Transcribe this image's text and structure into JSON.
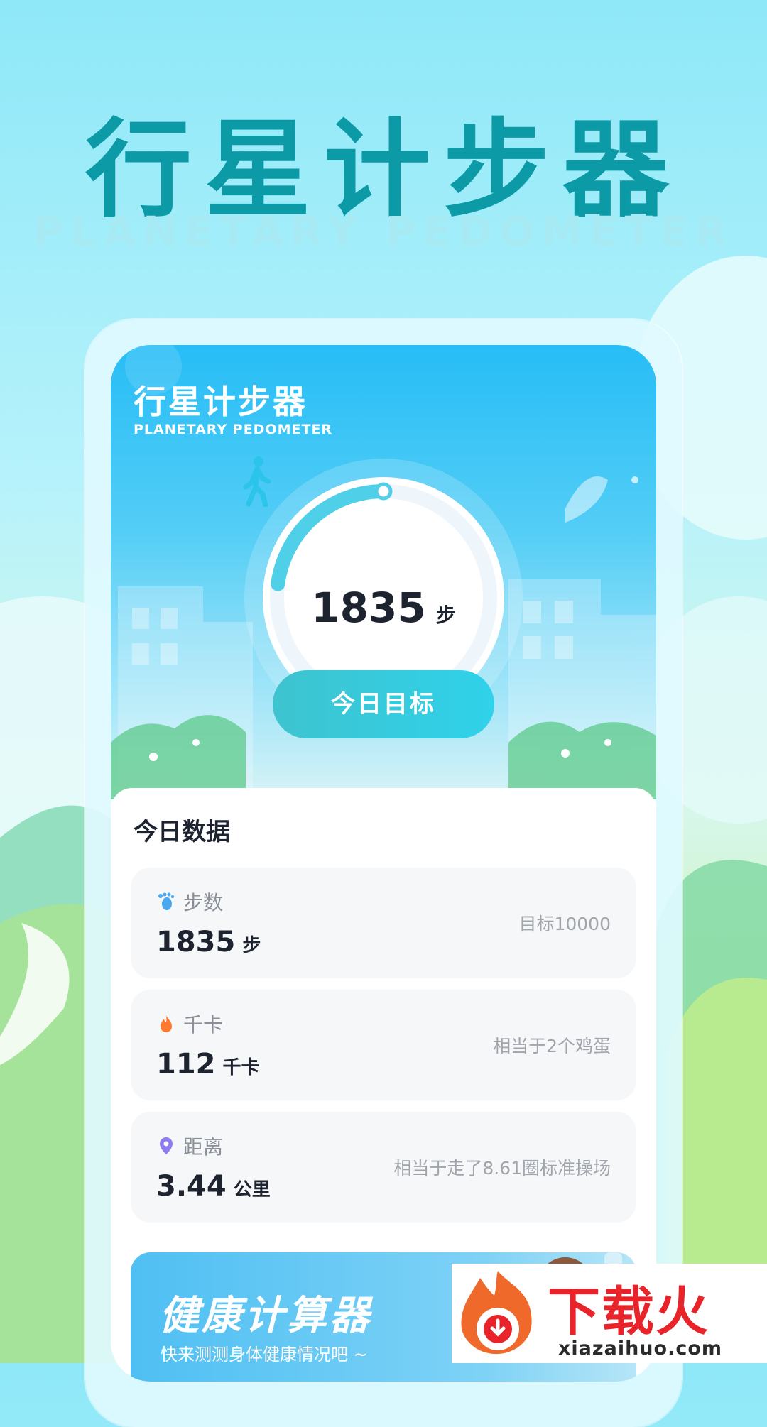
{
  "hero": {
    "title": "行星计步器",
    "subtitle": "PLANETARY PEDOMETER"
  },
  "app": {
    "title": "行星计步器",
    "subtitle": "PLANETARY PEDOMETER"
  },
  "progress": {
    "steps": "1835",
    "unit": "步",
    "goal_button": "今日目标",
    "fraction": 0.1835
  },
  "today": {
    "title": "今日数据",
    "stats": [
      {
        "icon": "footprint-icon",
        "label": "步数",
        "value": "1835",
        "unit": "步",
        "note": "目标10000",
        "color": "#4aa8f0"
      },
      {
        "icon": "flame-icon",
        "label": "千卡",
        "value": "112",
        "unit": "千卡",
        "note": "相当于2个鸡蛋",
        "color": "#ff7a2f"
      },
      {
        "icon": "location-pin-icon",
        "label": "距离",
        "value": "3.44",
        "unit": "公里",
        "note": "相当于走了8.61圈标准操场",
        "color": "#8c7cf0"
      }
    ]
  },
  "banner": {
    "title": "健康计算器",
    "subtitle": "快来测测身体健康情况吧 ~"
  },
  "watermark": {
    "brand": "下载火",
    "url": "xiazaihuo.com"
  },
  "colors": {
    "hero_title": "#0b9aa6",
    "accent": "#2fd2ea",
    "ring": "#4fd0e8"
  }
}
